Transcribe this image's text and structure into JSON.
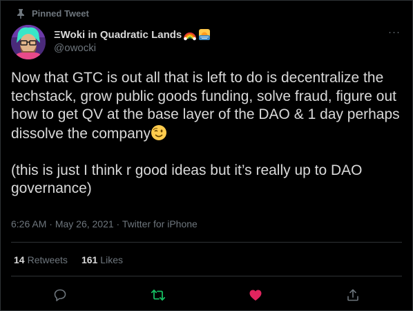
{
  "pinned": {
    "label": "Pinned Tweet",
    "icon": "pin-icon"
  },
  "author": {
    "display_name": "ΞWoki in Quadratic Lands",
    "name_emojis": [
      "rainbow-emoji",
      "sunrise-emoji"
    ],
    "handle": "@owocki",
    "avatar": "avatar-image"
  },
  "tweet": {
    "text_main": "Now that GTC is out all that is left to do is decentralize the techstack, grow public goods funding, solve fraud, figure out how to get QV at the base layer of the DAO & 1 day perhaps dissolve the company",
    "text_emoji": "winking-face-emoji",
    "text_second": "(this is just I think r good ideas but it’s really up to DAO governance)"
  },
  "meta": {
    "time": "6:26 AM",
    "date": "May 26, 2021",
    "source": "Twitter for iPhone",
    "separator": " · "
  },
  "stats": {
    "retweets_count": "14",
    "retweets_label": "Retweets",
    "likes_count": "161",
    "likes_label": "Likes"
  },
  "actions": {
    "reply": "reply-icon",
    "retweet": "retweet-icon",
    "like": "like-icon",
    "share": "share-icon"
  },
  "colors": {
    "background": "#000000",
    "text": "#d9d9d9",
    "muted": "#6e767d",
    "border": "#2f3336",
    "retweet_active": "#17bf63",
    "like_active": "#e0245e"
  }
}
